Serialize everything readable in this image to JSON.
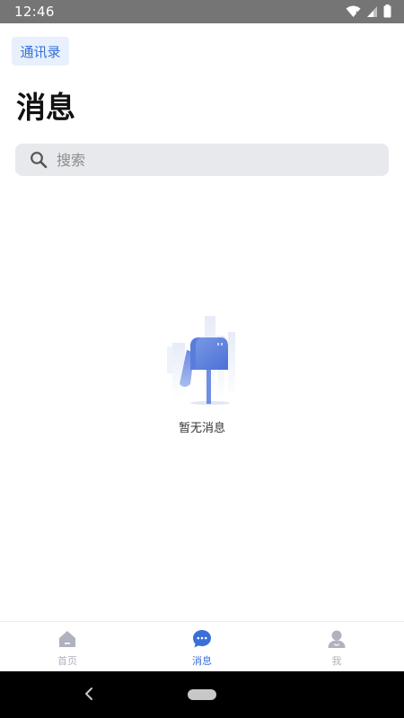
{
  "status_bar": {
    "time": "12:46"
  },
  "header": {
    "contacts_label": "通讯录",
    "title": "消息"
  },
  "search": {
    "placeholder": "搜索"
  },
  "empty_state": {
    "text": "暂无消息"
  },
  "tab_bar": {
    "tabs": [
      {
        "label": "首页",
        "icon": "home-icon",
        "active": false
      },
      {
        "label": "消息",
        "icon": "chat-bubble-icon",
        "active": true
      },
      {
        "label": "我",
        "icon": "person-icon",
        "active": false
      }
    ]
  },
  "colors": {
    "accent": "#3b6fd8",
    "status_bar": "#757575",
    "search_bg": "#e8e9ec",
    "inactive_tab": "#b0b3be"
  }
}
